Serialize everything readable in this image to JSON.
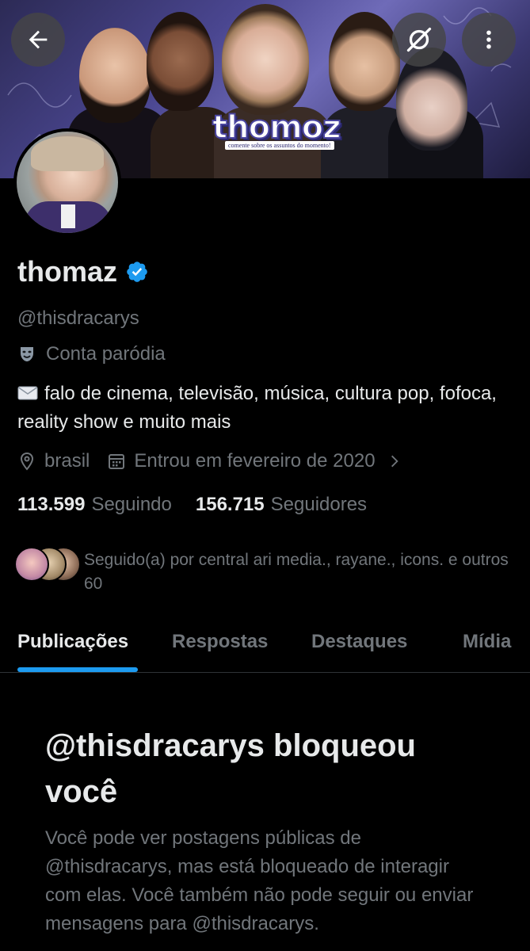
{
  "header": {
    "banner_logo": "thomoz",
    "banner_logo_sub": "comente sobre os assuntos do momento!"
  },
  "profile": {
    "display_name": "thomaz",
    "handle": "@thisdracarys",
    "parody_label": "Conta paródia",
    "bio": "falo de cinema, televisão, música, cultura pop, fofoca, reality show e muito mais",
    "location": "brasil",
    "joined": "Entrou em fevereiro de 2020",
    "following_count": "113.599",
    "following_label": "Seguindo",
    "followers_count": "156.715",
    "followers_label": "Seguidores",
    "followed_by": "Seguido(a) por central ari media., rayane., icons. e outros 60"
  },
  "tabs": [
    {
      "label": "Publicações"
    },
    {
      "label": "Respostas"
    },
    {
      "label": "Destaques"
    },
    {
      "label": "Mídia"
    }
  ],
  "blocked": {
    "title": "@thisdracarys bloqueou você",
    "description": "Você pode ver postagens públicas de @thisdracarys, mas está bloqueado de interagir com elas. Você também não pode seguir ou enviar mensagens para @thisdracarys."
  },
  "colors": {
    "accent": "#1d9bf0",
    "background": "#000000",
    "text_primary": "#e7e9ea",
    "text_secondary": "#71767b"
  },
  "icons": {
    "back": "arrow-left-icon",
    "grok": "grok-icon",
    "more": "more-vertical-icon",
    "verified": "verified-badge-icon",
    "parody": "theater-mask-icon",
    "bio_prefix": "envelope-icon",
    "location": "location-pin-icon",
    "calendar": "calendar-icon",
    "chevron": "chevron-right-icon"
  }
}
